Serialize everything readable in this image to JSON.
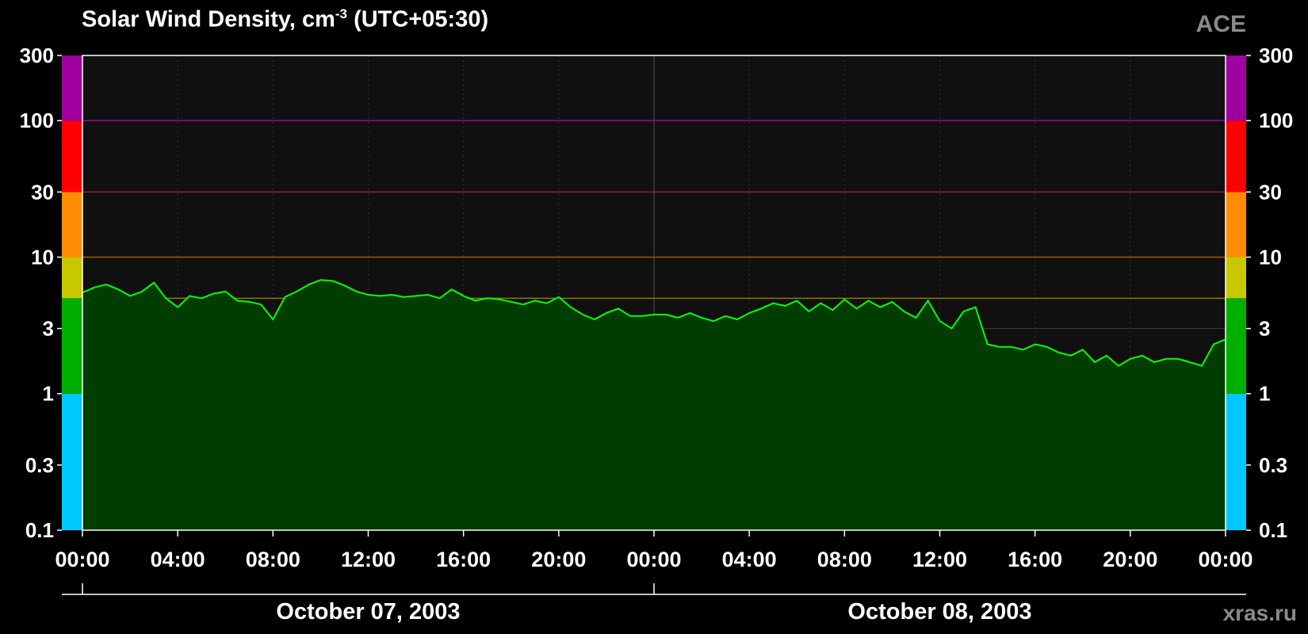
{
  "chart_data": {
    "type": "line",
    "title_main": "Solar Wind Density, cm",
    "title_sup": "-3",
    "title_tz": "(UTC+05:30)",
    "brand": "ACE",
    "credit": "xras.ru",
    "yscale": "log",
    "ylim": [
      0.1,
      300
    ],
    "y_ticks": [
      "0.1",
      "0.3",
      "1",
      "3",
      "10",
      "30",
      "100",
      "300"
    ],
    "y_tick_values": [
      0.1,
      0.3,
      1,
      3,
      10,
      30,
      100,
      300
    ],
    "xlim_hours": [
      0,
      48
    ],
    "x_ticks": [
      "00:00",
      "04:00",
      "08:00",
      "12:00",
      "16:00",
      "20:00",
      "00:00",
      "04:00",
      "08:00",
      "12:00",
      "16:00",
      "20:00",
      "00:00"
    ],
    "dates": [
      "October 07, 2003",
      "October 08, 2003"
    ],
    "line_color": "#00ff00",
    "fill_color": "#003d00",
    "threshold_lines": [
      {
        "value": 5,
        "color": "#8a7a00"
      },
      {
        "value": 10,
        "color": "#a05a00"
      },
      {
        "value": 30,
        "color": "#a02020"
      },
      {
        "value": 100,
        "color": "#a000a0"
      }
    ],
    "color_bands": [
      {
        "from": 0.1,
        "to": 1,
        "color": "#00c8ff"
      },
      {
        "from": 1,
        "to": 5,
        "color": "#00b000"
      },
      {
        "from": 5,
        "to": 10,
        "color": "#c8c800"
      },
      {
        "from": 10,
        "to": 30,
        "color": "#ff8c00"
      },
      {
        "from": 30,
        "to": 100,
        "color": "#ff0000"
      },
      {
        "from": 100,
        "to": 300,
        "color": "#a000a0"
      }
    ],
    "series": [
      {
        "x": [
          0,
          0.5,
          1,
          1.5,
          2,
          2.5,
          3,
          3.5,
          4,
          4.5,
          5,
          5.5,
          6,
          6.5,
          7,
          7.5,
          8,
          8.5,
          9,
          9.5,
          10,
          10.5,
          11,
          11.5,
          12,
          12.5,
          13,
          13.5,
          14,
          14.5,
          15,
          15.5,
          16,
          16.5,
          17,
          17.5,
          18,
          18.5,
          19,
          19.5,
          20,
          20.5,
          21,
          21.5,
          22,
          22.5,
          23,
          23.5,
          24,
          24.5,
          25,
          25.5,
          26,
          26.5,
          27,
          27.5,
          28,
          28.5,
          29,
          29.5,
          30,
          30.5,
          31,
          31.5,
          32,
          32.5,
          33,
          33.5,
          34,
          34.5,
          35,
          35.5,
          36,
          36.5,
          37,
          37.5,
          38,
          38.5,
          39,
          39.5,
          40,
          40.5,
          41,
          41.5,
          42,
          42.5,
          43,
          43.5,
          44,
          44.5,
          45,
          45.5,
          46,
          46.5,
          47,
          47.5,
          48
        ],
        "y": [
          5.5,
          6.0,
          6.3,
          5.8,
          5.2,
          5.6,
          6.5,
          5.0,
          4.3,
          5.2,
          5.0,
          5.4,
          5.6,
          4.8,
          4.7,
          4.5,
          3.5,
          5.1,
          5.6,
          6.3,
          6.8,
          6.7,
          6.2,
          5.6,
          5.3,
          5.2,
          5.3,
          5.1,
          5.2,
          5.3,
          5.0,
          5.8,
          5.2,
          4.8,
          5.0,
          4.9,
          4.7,
          4.5,
          4.8,
          4.6,
          5.1,
          4.3,
          3.8,
          3.5,
          3.9,
          4.2,
          3.7,
          3.7,
          3.8,
          3.8,
          3.6,
          3.9,
          3.6,
          3.4,
          3.7,
          3.5,
          3.9,
          4.2,
          4.6,
          4.4,
          4.8,
          4.0,
          4.6,
          4.1,
          4.9,
          4.2,
          4.8,
          4.3,
          4.7,
          4.0,
          3.6,
          4.8,
          3.4,
          3.0,
          4.0,
          4.3,
          2.3,
          2.2,
          2.2,
          2.1,
          2.3,
          2.2,
          2.0,
          1.9,
          2.1,
          1.7,
          1.9,
          1.6,
          1.8,
          1.9,
          1.7,
          1.8,
          1.8,
          1.7,
          1.6,
          2.3,
          2.5
        ]
      }
    ]
  }
}
